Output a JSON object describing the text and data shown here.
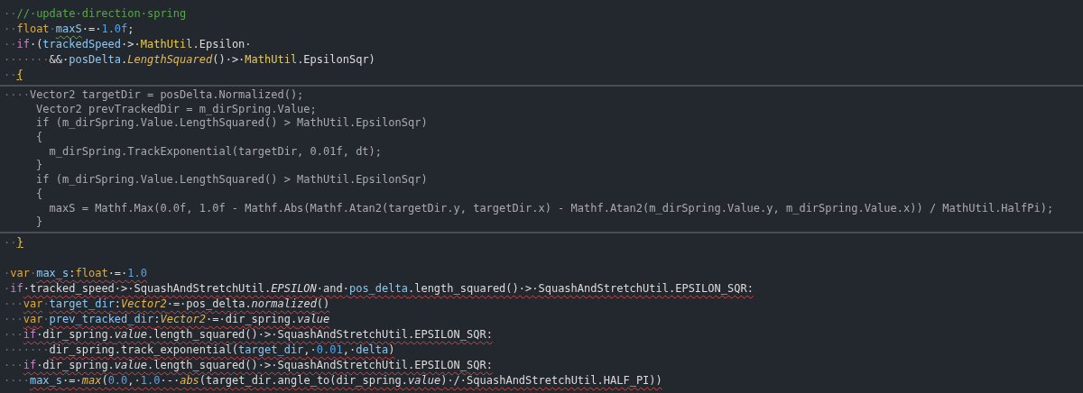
{
  "sections": [
    {
      "kind": "code",
      "lines": [
        [
          {
            "t": "··",
            "kind": "ws"
          },
          {
            "t": "//·update·direction·spring",
            "kind": "comment"
          }
        ],
        [
          {
            "t": "··",
            "kind": "ws"
          },
          {
            "t": "float",
            "kind": "type"
          },
          {
            "t": "·",
            "kind": "ws"
          },
          {
            "t": "maxS",
            "kind": "var",
            "warning": true
          },
          {
            "t": "·=·",
            "kind": "plain"
          },
          {
            "t": "1.0f",
            "kind": "num"
          },
          {
            "t": ";",
            "kind": "plain"
          }
        ],
        [
          {
            "t": "··",
            "kind": "ws"
          },
          {
            "t": "if",
            "kind": "keyword"
          },
          {
            "t": "·(",
            "kind": "plain"
          },
          {
            "t": "trackedSpeed",
            "kind": "var"
          },
          {
            "t": "·>·",
            "kind": "plain"
          },
          {
            "t": "MathUtil",
            "kind": "cls"
          },
          {
            "t": ".Epsilon·",
            "kind": "plain"
          }
        ],
        [
          {
            "t": "·······",
            "kind": "ws"
          },
          {
            "t": "&&·",
            "kind": "plain"
          },
          {
            "t": "posDelta",
            "kind": "var"
          },
          {
            "t": ".",
            "kind": "plain"
          },
          {
            "t": "LengthSquared",
            "kind": "fn"
          },
          {
            "t": "()·>·",
            "kind": "plain"
          },
          {
            "t": "MathUtil",
            "kind": "cls"
          },
          {
            "t": ".EpsilonSqr)",
            "kind": "plain"
          }
        ],
        [
          {
            "t": "··",
            "kind": "ws"
          },
          {
            "t": "{",
            "kind": "brace"
          }
        ]
      ]
    },
    {
      "kind": "embedded",
      "lines": [
        [
          {
            "t": "····",
            "kind": "ws"
          },
          {
            "t": "Vector2 targetDir = posDelta.Normalized();",
            "kind": "dim"
          }
        ],
        [
          {
            "t": "     Vector2 prevTrackedDir = m_dirSpring.Value;",
            "kind": "dim"
          }
        ],
        [
          {
            "t": "     if (m_dirSpring.Value.LengthSquared() > MathUtil.EpsilonSqr)",
            "kind": "dim"
          }
        ],
        [
          {
            "t": "     {",
            "kind": "dim"
          }
        ],
        [
          {
            "t": "       m_dirSpring.TrackExponential(targetDir, 0.01f, dt);",
            "kind": "dim"
          }
        ],
        [
          {
            "t": "     }",
            "kind": "dim"
          }
        ],
        [
          {
            "t": "     if (m_dirSpring.Value.LengthSquared() > MathUtil.EpsilonSqr)",
            "kind": "dim"
          }
        ],
        [
          {
            "t": "     {",
            "kind": "dim"
          }
        ],
        [
          {
            "t": "       maxS = Mathf.Max(0.0f, 1.0f - Mathf.Abs(Mathf.Atan2(targetDir.y, targetDir.x) - Mathf.Atan2(m_dirSpring.Value.y, m_dirSpring.Value.x)) / MathUtil.HalfPi);",
            "kind": "dim"
          }
        ],
        [
          {
            "t": "     }",
            "kind": "dim"
          }
        ]
      ]
    },
    {
      "kind": "code",
      "lines": [
        [
          {
            "t": "··",
            "kind": "ws"
          },
          {
            "t": "}",
            "kind": "brace"
          }
        ]
      ]
    },
    {
      "kind": "code",
      "lines": [
        [
          {
            "t": "·",
            "kind": "ws"
          },
          {
            "t": "var",
            "kind": "type"
          },
          {
            "t": "·",
            "kind": "ws"
          },
          {
            "t": "max_s",
            "kind": "var",
            "error": true
          },
          {
            "t": ":",
            "kind": "plain",
            "error": true
          },
          {
            "t": "float",
            "kind": "type",
            "error": true
          },
          {
            "t": "·=·",
            "kind": "plain",
            "error": true
          },
          {
            "t": "1.0",
            "kind": "num",
            "error": true
          }
        ],
        [
          {
            "t": "·",
            "kind": "ws"
          },
          {
            "t": "if",
            "kind": "keyword"
          },
          {
            "t": "·tracked_speed·>·SquashAndStretchUtil.",
            "kind": "plain",
            "error": true
          },
          {
            "t": "EPSILON",
            "kind": "italic",
            "error": true
          },
          {
            "t": "·and·",
            "kind": "plain",
            "error": true
          },
          {
            "t": "pos_delta",
            "kind": "var",
            "error": true
          },
          {
            "t": ".length_squared()·>·SquashAndStretchUtil.EPSILON_SQR:",
            "kind": "plain",
            "error": true
          }
        ],
        [
          {
            "t": "···",
            "kind": "ws"
          },
          {
            "t": "var",
            "kind": "type",
            "error": true
          },
          {
            "t": "·",
            "kind": "ws"
          },
          {
            "t": "target_dir",
            "kind": "var",
            "error": true
          },
          {
            "t": ":",
            "kind": "plain",
            "error": true
          },
          {
            "t": "Vector2",
            "kind": "fn",
            "error": true
          },
          {
            "t": "·=·",
            "kind": "plain",
            "error": true
          },
          {
            "t": "pos_delta.",
            "kind": "plain",
            "error": true
          },
          {
            "t": "normalized",
            "kind": "italic",
            "error": true
          },
          {
            "t": "()",
            "kind": "plain",
            "error": true
          }
        ],
        [
          {
            "t": "···",
            "kind": "ws"
          },
          {
            "t": "var",
            "kind": "type",
            "error": true
          },
          {
            "t": "·",
            "kind": "ws"
          },
          {
            "t": "prev_tracked_dir",
            "kind": "var",
            "error": true
          },
          {
            "t": ":",
            "kind": "plain",
            "error": true
          },
          {
            "t": "Vector2",
            "kind": "fn",
            "error": true
          },
          {
            "t": "·=·",
            "kind": "plain",
            "error": true
          },
          {
            "t": "dir_spring.",
            "kind": "plain",
            "error": true
          },
          {
            "t": "value",
            "kind": "italic",
            "error": true
          }
        ],
        [
          {
            "t": "···",
            "kind": "ws"
          },
          {
            "t": "if",
            "kind": "keyword",
            "error": true
          },
          {
            "t": "·dir_spring.",
            "kind": "plain",
            "error": true
          },
          {
            "t": "value",
            "kind": "italic",
            "error": true
          },
          {
            "t": ".length_squared()·>·SquashAndStretchUtil.EPSILON_SQR:",
            "kind": "plain",
            "error": true
          }
        ],
        [
          {
            "t": "·······",
            "kind": "ws"
          },
          {
            "t": "dir_spring.track_exponential(",
            "kind": "plain",
            "error": true
          },
          {
            "t": "target_dir",
            "kind": "var",
            "error": true
          },
          {
            "t": ",·",
            "kind": "plain",
            "error": true
          },
          {
            "t": "0.01",
            "kind": "num",
            "error": true
          },
          {
            "t": ",·",
            "kind": "plain",
            "error": true
          },
          {
            "t": "delta",
            "kind": "var",
            "error": true
          },
          {
            "t": ")",
            "kind": "plain",
            "error": true
          }
        ],
        [
          {
            "t": "···",
            "kind": "ws"
          },
          {
            "t": "if",
            "kind": "keyword",
            "error": true
          },
          {
            "t": "·dir_spring.",
            "kind": "plain",
            "error": true
          },
          {
            "t": "value",
            "kind": "italic",
            "error": true
          },
          {
            "t": ".length_squared()·>·SquashAndStretchUtil.EPSILON_SQR:",
            "kind": "plain",
            "error": true
          }
        ],
        [
          {
            "t": "····",
            "kind": "ws"
          },
          {
            "t": "max_s",
            "kind": "var",
            "error": true
          },
          {
            "t": "·=·",
            "kind": "plain",
            "error": true
          },
          {
            "t": "max",
            "kind": "fn",
            "error": true
          },
          {
            "t": "(",
            "kind": "plain",
            "error": true
          },
          {
            "t": "0.0",
            "kind": "num",
            "error": true
          },
          {
            "t": ",·",
            "kind": "plain",
            "error": true
          },
          {
            "t": "1.0",
            "kind": "num",
            "error": true
          },
          {
            "t": "·-·",
            "kind": "plain",
            "error": true
          },
          {
            "t": "abs",
            "kind": "fn",
            "error": true
          },
          {
            "t": "(target_dir.angle_to(dir_spring.",
            "kind": "plain",
            "error": true
          },
          {
            "t": "value",
            "kind": "italic",
            "error": true
          },
          {
            "t": ")·/·SquashAndStretchUtil.HALF_PI))",
            "kind": "plain",
            "error": true
          }
        ]
      ]
    }
  ]
}
